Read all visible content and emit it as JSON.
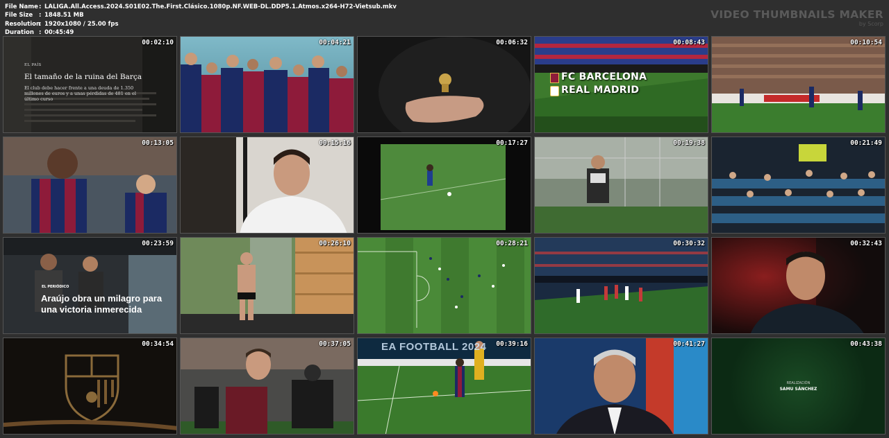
{
  "meta": [
    {
      "key": "File Name",
      "value": "LALIGA.All.Access.2024.S01E02.The.First.Clásico.1080p.NF.WEB-DL.DDP5.1.Atmos.x264-H72-Vietsub.mkv"
    },
    {
      "key": "File Size",
      "value": "1848.51 MB"
    },
    {
      "key": "Resolution",
      "value": "1920x1080 / 25.00 fps"
    },
    {
      "key": "Duration",
      "value": "00:45:49"
    }
  ],
  "brand": {
    "title": "VIDEO THUMBNAILS MAKER",
    "sub": "by Scorp"
  },
  "thumbnails": [
    {
      "time": "00:02:10",
      "scene": "newspaper-elpais"
    },
    {
      "time": "00:04:21",
      "scene": "players-celebrating"
    },
    {
      "time": "00:06:32",
      "scene": "hand-on-crest"
    },
    {
      "time": "00:08:43",
      "scene": "stadium-title-card"
    },
    {
      "time": "00:10:54",
      "scene": "match-play-stands"
    },
    {
      "time": "00:13:05",
      "scene": "players-closeup"
    },
    {
      "time": "00:15:16",
      "scene": "player-interview-hoodie"
    },
    {
      "time": "00:17:27",
      "scene": "archive-pitch"
    },
    {
      "time": "00:19:38",
      "scene": "training-pitch"
    },
    {
      "time": "00:21:49",
      "scene": "vip-stands"
    },
    {
      "time": "00:23:59",
      "scene": "newspaper-elperiodico"
    },
    {
      "time": "00:26:10",
      "scene": "sauna-room"
    },
    {
      "time": "00:28:21",
      "scene": "aerial-pitch"
    },
    {
      "time": "00:30:32",
      "scene": "night-match"
    },
    {
      "time": "00:32:43",
      "scene": "coach-interview"
    },
    {
      "time": "00:34:54",
      "scene": "crest-gold"
    },
    {
      "time": "00:37:05",
      "scene": "player-tunnel"
    },
    {
      "time": "00:39:16",
      "scene": "goal-action"
    },
    {
      "time": "00:41:27",
      "scene": "president-interview"
    },
    {
      "time": "00:43:38",
      "scene": "end-credits"
    }
  ],
  "overlays": {
    "elpais_source": "EL PAÍS",
    "elpais_headline": "El tamaño de la ruina del Barça",
    "elpais_body": "El club debe hacer frente a una deuda de 1.350 millones de euros y a unas pérdidas de 481 en el último curso",
    "team1": "FC BARCELONA",
    "team2": "REAL MADRID",
    "elperiodico_source": "EL PERIÓDICO",
    "elperiodico_headline": "Araújo obra un milagro para una victoria inmerecida",
    "board_text": "EA FOOTBALL 2024",
    "credit_role": "REALIZACIÓN",
    "credit_name": "SAMU SÁNCHEZ"
  },
  "colors": {
    "background": "#2f2f2f",
    "brand_text": "#5a5a5a",
    "barca_blue": "#1b2a63",
    "barca_red": "#8e1b3a",
    "pitch_green": "#3d7a2d"
  }
}
